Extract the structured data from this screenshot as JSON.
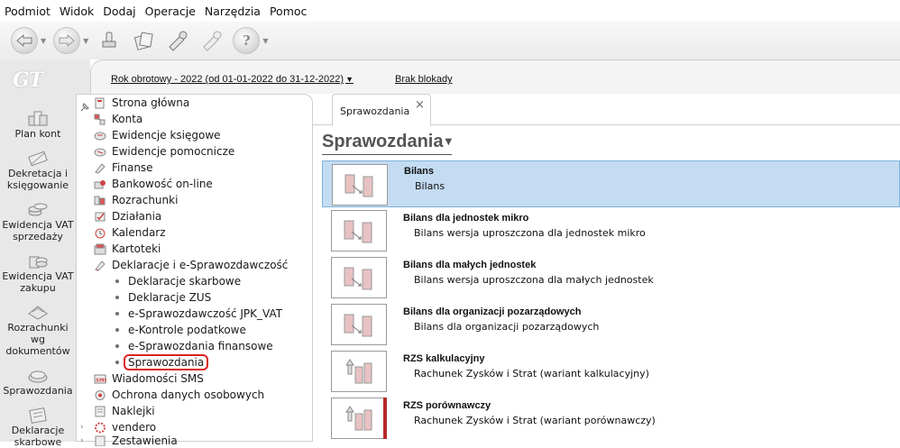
{
  "menu": [
    "Podmiot",
    "Widok",
    "Dodaj",
    "Operacje",
    "Narzędzia",
    "Pomoc"
  ],
  "toolbar": {
    "buttons": [
      {
        "icon": "back-arrow-icon"
      },
      {
        "icon": "forward-arrow-icon"
      },
      {
        "icon": "stamp-icon"
      },
      {
        "icon": "documents-icon"
      },
      {
        "icon": "tools-icon"
      },
      {
        "icon": "tools-disabled-icon"
      },
      {
        "icon": "help-icon"
      }
    ]
  },
  "logo": "GT",
  "sidebar": {
    "items": [
      {
        "label": "Plan kont",
        "icon": "chart-of-accounts-icon"
      },
      {
        "label": "Dekretacja i księgowanie",
        "icon": "posting-icon"
      },
      {
        "label": "Ewidencja VAT sprzedaży",
        "icon": "vat-sales-icon"
      },
      {
        "label": "Ewidencja VAT zakupu",
        "icon": "vat-purchase-icon"
      },
      {
        "label": "Rozrachunki wg dokumentów",
        "icon": "settlements-icon"
      },
      {
        "label": "Sprawozdania",
        "icon": "reports-icon"
      },
      {
        "label": "Deklaracje skarbowe",
        "icon": "tax-declarations-icon"
      }
    ]
  },
  "header": {
    "fiscal_year": "Rok obrotowy - 2022  (od 01-01-2022 do 31-12-2022)",
    "lock_status": "Brak blokady"
  },
  "tree": {
    "items": [
      {
        "label": "Strona główna",
        "icon": "home-icon"
      },
      {
        "label": "Konta",
        "icon": "accounts-icon"
      },
      {
        "label": "Ewidencje księgowe",
        "icon": "ledger-icon"
      },
      {
        "label": "Ewidencje pomocnicze",
        "icon": "auxiliary-ledger-icon"
      },
      {
        "label": "Finanse",
        "icon": "finance-icon"
      },
      {
        "label": "Bankowość on-line",
        "icon": "online-banking-icon"
      },
      {
        "label": "Rozrachunki",
        "icon": "settlements-icon"
      },
      {
        "label": "Działania",
        "icon": "actions-icon"
      },
      {
        "label": "Kalendarz",
        "icon": "calendar-icon"
      },
      {
        "label": "Kartoteki",
        "icon": "records-icon"
      },
      {
        "label": "Deklaracje i e-Sprawozdawczość",
        "icon": "declarations-icon"
      }
    ],
    "subitems": [
      "Deklaracje skarbowe",
      "Deklaracje ZUS",
      "e-Sprawozdawczość JPK_VAT",
      "e-Kontrole podatkowe",
      "e-Sprawozdania finansowe",
      "Sprawozdania"
    ],
    "items_after": [
      {
        "label": "Wiadomości SMS",
        "icon": "sms-icon"
      },
      {
        "label": "Ochrona danych osobowych",
        "icon": "data-protection-icon"
      },
      {
        "label": "Naklejki",
        "icon": "labels-icon"
      },
      {
        "label": "vendero",
        "icon": "vendero-icon"
      },
      {
        "label": "Zestawienia",
        "icon": "statements-icon"
      }
    ]
  },
  "tab": {
    "label": "Sprawozdania",
    "close": "×"
  },
  "heading": "Sprawozdania",
  "reports": [
    {
      "title": "Bilans",
      "desc": "Bilans",
      "selected": true
    },
    {
      "title": "Bilans dla jednostek mikro",
      "desc": "Bilans wersja uproszczona dla jednostek mikro"
    },
    {
      "title": "Bilans dla małych jednostek",
      "desc": "Bilans wersja uproszczona dla małych jednostek"
    },
    {
      "title": "Bilans dla organizacji pozarządowych",
      "desc": "Bilans dla organizacji pozarządowych"
    },
    {
      "title": "RZS kalkulacyjny",
      "desc": "Rachunek Zysków i Strat (wariant kalkulacyjny)"
    },
    {
      "title": "RZS porównawczy",
      "desc": "Rachunek Zysków i Strat (wariant porównawczy)"
    }
  ],
  "colors": {
    "selected_row": "#c4dcf2",
    "selected_border": "#7fb2dd",
    "highlight_box": "#e02020",
    "accent_bar": "#b52a2a"
  }
}
